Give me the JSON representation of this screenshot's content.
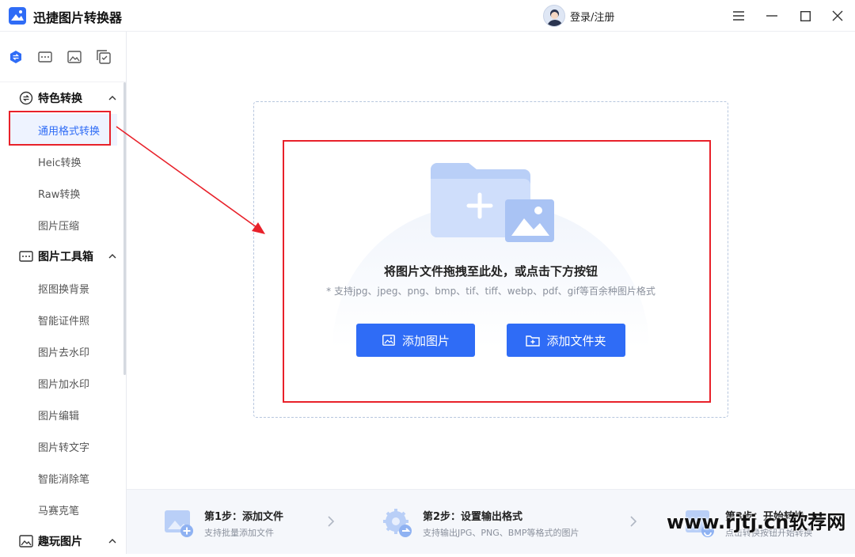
{
  "app": {
    "title": "迅捷图片转换器",
    "login_label": "登录/注册"
  },
  "icons": {
    "logo": "app-logo-icon",
    "menu": "hamburger-menu-icon",
    "minimize": "minimize-icon",
    "maximize": "maximize-icon",
    "close": "close-icon"
  },
  "sidebar": {
    "groups": [
      {
        "label": "特色转换",
        "items": [
          "通用格式转换",
          "Heic转换",
          "Raw转换",
          "图片压缩"
        ]
      },
      {
        "label": "图片工具箱",
        "items": [
          "抠图换背景",
          "智能证件照",
          "图片去水印",
          "图片加水印",
          "图片编辑",
          "图片转文字",
          "智能消除笔",
          "马赛克笔"
        ]
      },
      {
        "label": "趣玩图片",
        "items": []
      }
    ],
    "active_item": "通用格式转换"
  },
  "dropzone": {
    "title": "将图片文件拖拽至此处，或点击下方按钮",
    "subtitle": "* 支持jpg、jpeg、png、bmp、tif、tiff、webp、pdf、gif等百余种图片格式",
    "add_image_label": "添加图片",
    "add_folder_label": "添加文件夹"
  },
  "steps": [
    {
      "title": "第1步：添加文件",
      "desc": "支持批量添加文件"
    },
    {
      "title": "第2步：设置输出格式",
      "desc": "支持输出JPG、PNG、BMP等格式的图片"
    },
    {
      "title": "第3步：开始转换",
      "desc": "点击转换按钮开始转换"
    }
  ],
  "watermark": "www.rjtj.cn软荐网",
  "colors": {
    "accent": "#2f6cf6",
    "annotation": "#e8212a"
  }
}
